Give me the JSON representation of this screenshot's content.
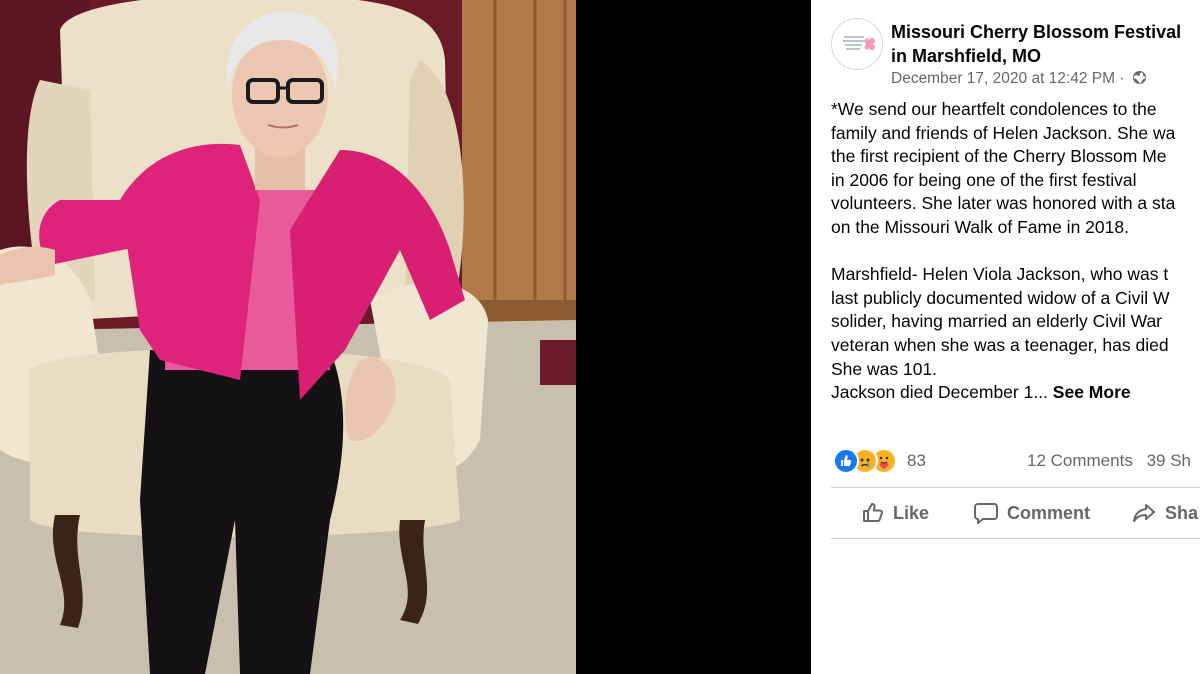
{
  "post": {
    "page_name": "Missouri Cherry Blossom Festival in Marshfield, MO",
    "timestamp": "December 17, 2020 at 12:42 PM",
    "separator": "·",
    "audience_icon": "globe-icon",
    "text_lines_1": [
      "*We send our heartfelt condolences to the",
      "family and friends of Helen Jackson. She wa",
      "the first recipient of the Cherry Blossom Me",
      "in 2006 for being one of the first festival",
      "volunteers. She later was honored with a sta",
      "on the Missouri Walk of Fame in 2018."
    ],
    "text_lines_2": [
      "Marshfield- Helen Viola Jackson, who was t",
      "last publicly documented widow of a Civil W",
      "solider, having married an elderly Civil War",
      "veteran when she was a teenager, has died",
      "She was 101."
    ],
    "truncated_line": "Jackson died December 1...",
    "see_more": "See More"
  },
  "engagement": {
    "reaction_icons": [
      "like-reaction-icon",
      "sad-reaction-icon",
      "care-reaction-icon"
    ],
    "reaction_count": "83",
    "comments": "12 Comments",
    "shares": "39 Sh"
  },
  "actions": {
    "like": "Like",
    "comment": "Comment",
    "share": "Sha"
  },
  "colors": {
    "facebook_blue": "#1877f2",
    "text_primary": "#050505",
    "text_secondary": "#65676b",
    "jacket_pink": "#e0237a"
  }
}
